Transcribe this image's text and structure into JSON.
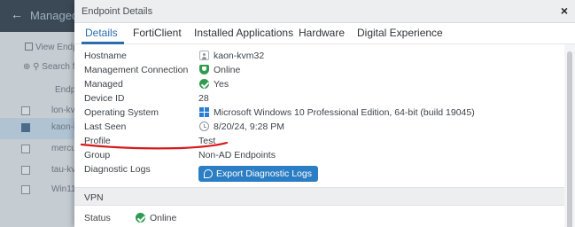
{
  "background_page": {
    "title": "Managed E",
    "toolbar_label": "View Endp",
    "search_placeholder": "Search f",
    "column_header": "Endpo",
    "rows": [
      {
        "name": "lon-kv",
        "selected": false
      },
      {
        "name": "kaon-k",
        "selected": true
      },
      {
        "name": "mercu",
        "selected": false
      },
      {
        "name": "tau-kv",
        "selected": false
      },
      {
        "name": "Win11",
        "selected": false
      }
    ]
  },
  "modal": {
    "title": "Endpoint Details",
    "close_icon": "×",
    "tabs": [
      "Details",
      "FortiClient",
      "Installed Applications",
      "Hardware",
      "Digital Experience"
    ],
    "active_tab": 0
  },
  "details": {
    "hostname": {
      "label": "Hostname",
      "value": "kaon-kvm32",
      "icon": "user-icon"
    },
    "management_connection": {
      "label": "Management Connection",
      "value": "Online",
      "icon": "shield-icon"
    },
    "managed": {
      "label": "Managed",
      "value": "Yes",
      "icon": "check-circle-icon"
    },
    "device_id": {
      "label": "Device ID",
      "value": "28"
    },
    "operating_system": {
      "label": "Operating System",
      "value": "Microsoft Windows 10 Professional Edition, 64-bit (build 19045)",
      "icon": "windows-icon"
    },
    "last_seen": {
      "label": "Last Seen",
      "value": "8/20/24, 9:28 PM",
      "icon": "clock-icon"
    },
    "profile": {
      "label": "Profile",
      "value": "Test"
    },
    "group": {
      "label": "Group",
      "value": "Non-AD Endpoints"
    },
    "diagnostic_logs": {
      "label": "Diagnostic Logs",
      "button": "Export Diagnostic Logs",
      "icon": "stethoscope-icon"
    }
  },
  "vpn": {
    "section_title": "VPN",
    "status": {
      "label": "Status",
      "value": "Online",
      "icon": "check-circle-icon"
    }
  },
  "colors": {
    "accent": "#2b6cb0",
    "button": "#2c7ec4",
    "online_green": "#2e9b4f",
    "annotation_red": "#d7191c"
  }
}
